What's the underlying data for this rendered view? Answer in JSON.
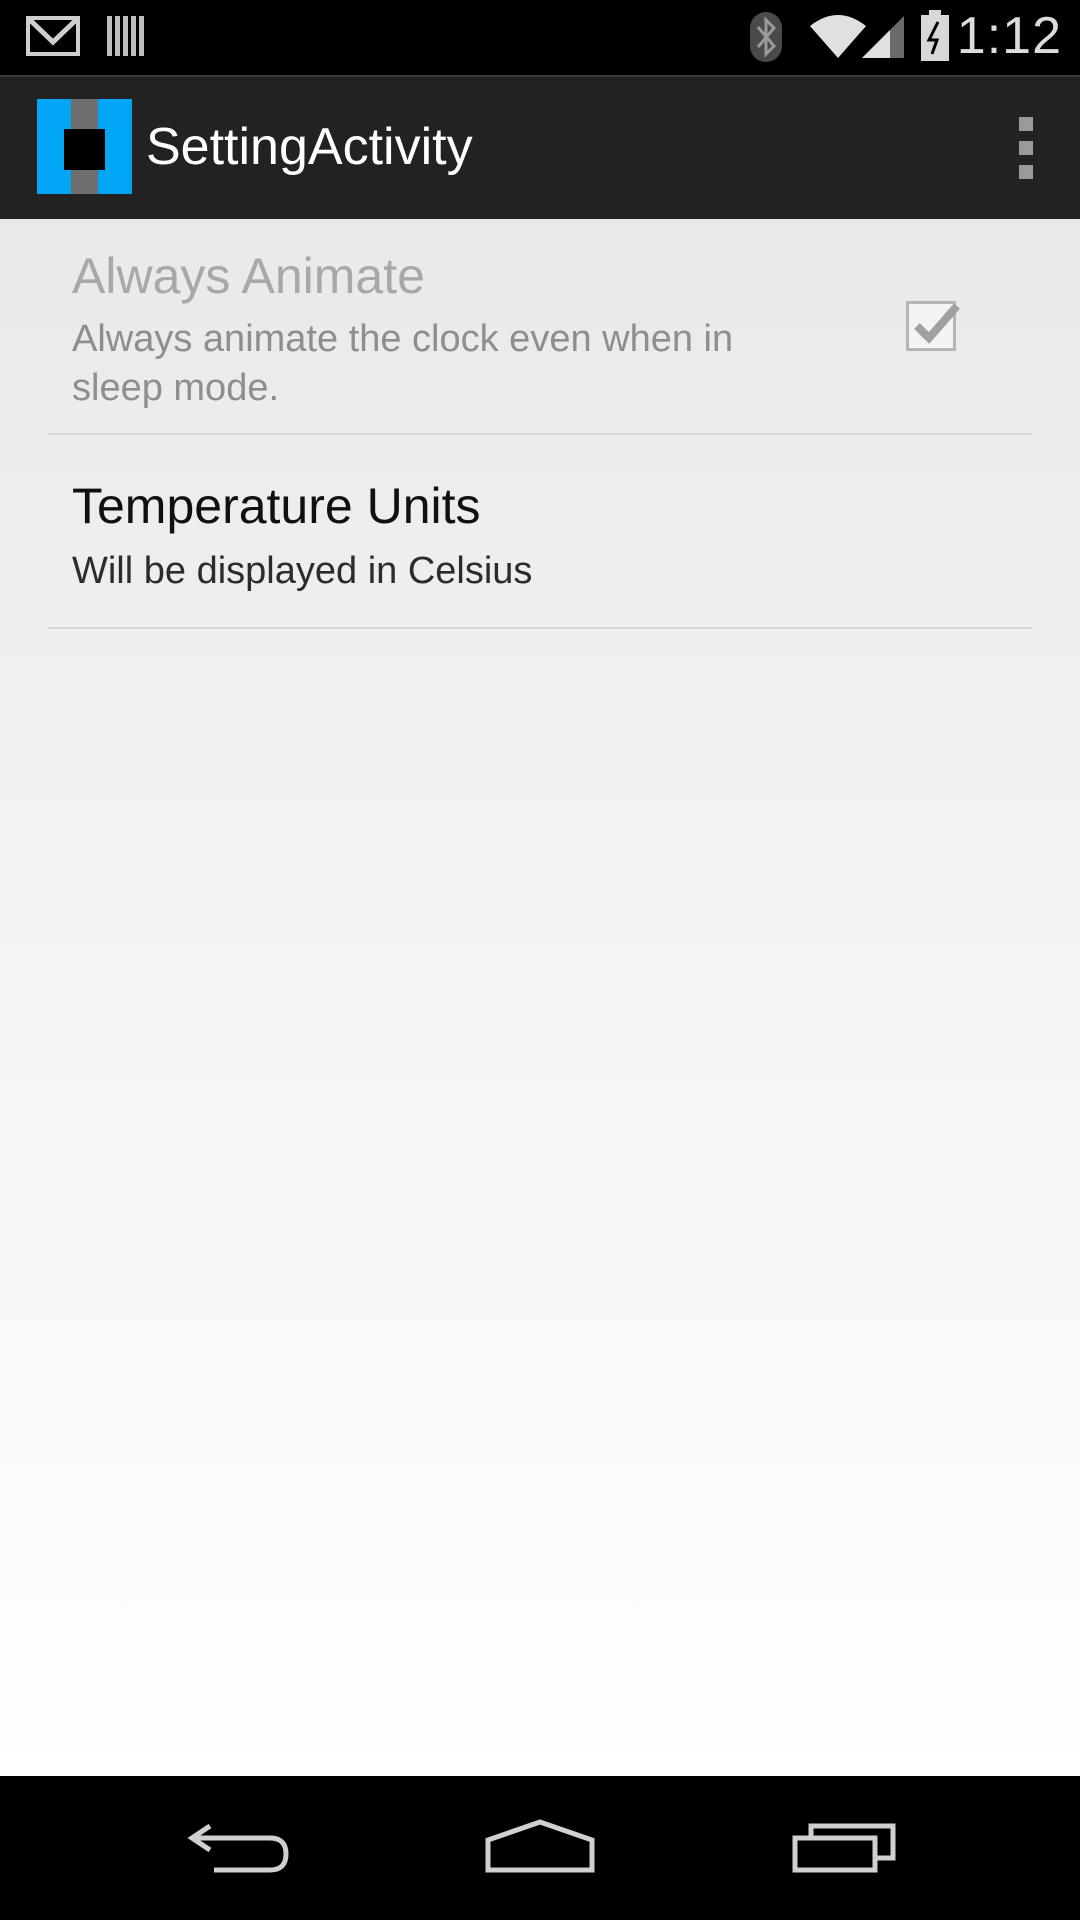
{
  "status_bar": {
    "time": "1:12",
    "icons": [
      "gmail-icon",
      "barcode-icon",
      "bluetooth-icon",
      "wifi-icon",
      "signal-icon",
      "battery-charging-icon"
    ]
  },
  "action_bar": {
    "title": "SettingActivity",
    "overflow_icon": "overflow-menu-icon"
  },
  "preferences": [
    {
      "title": "Always Animate",
      "summary": "Always animate the clock even when in sleep mode.",
      "checked": true,
      "enabled": false
    },
    {
      "title": "Temperature Units",
      "summary": "Will be displayed in Celsius",
      "enabled": true
    }
  ],
  "nav_bar": {
    "buttons": [
      "back-icon",
      "home-icon",
      "recents-icon"
    ]
  },
  "colors": {
    "app_icon_blue": "#00a6f5",
    "action_bar_bg": "#222222"
  }
}
